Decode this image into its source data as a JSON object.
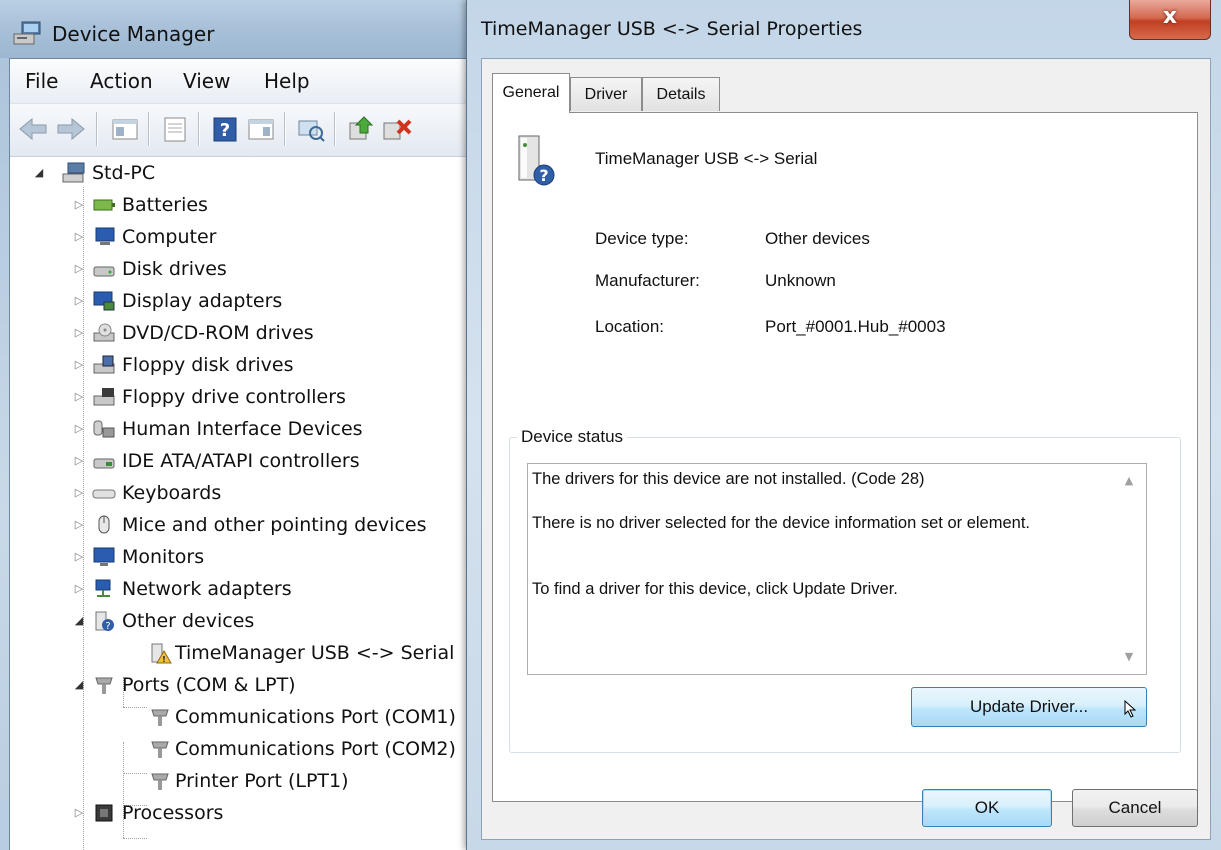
{
  "device_manager": {
    "title": "Device Manager",
    "menu": [
      "File",
      "Action",
      "View",
      "Help"
    ],
    "toolbar_icons": [
      "back-arrow-icon",
      "forward-arrow-icon",
      "show-hide-console-tree-icon",
      "properties-icon",
      "help-icon",
      "action-pane-icon",
      "scan-hardware-icon",
      "update-driver-icon",
      "uninstall-icon"
    ],
    "tree": {
      "root": "Std-PC",
      "categories": [
        {
          "label": "Batteries",
          "icon": "battery-icon",
          "expanded": false
        },
        {
          "label": "Computer",
          "icon": "computer-icon",
          "expanded": false
        },
        {
          "label": "Disk drives",
          "icon": "disk-drive-icon",
          "expanded": false
        },
        {
          "label": "Display adapters",
          "icon": "display-adapter-icon",
          "expanded": false
        },
        {
          "label": "DVD/CD-ROM drives",
          "icon": "dvd-drive-icon",
          "expanded": false
        },
        {
          "label": "Floppy disk drives",
          "icon": "floppy-drive-icon",
          "expanded": false
        },
        {
          "label": "Floppy drive controllers",
          "icon": "floppy-controller-icon",
          "expanded": false
        },
        {
          "label": "Human Interface Devices",
          "icon": "hid-icon",
          "expanded": false
        },
        {
          "label": "IDE ATA/ATAPI controllers",
          "icon": "ide-controller-icon",
          "expanded": false
        },
        {
          "label": "Keyboards",
          "icon": "keyboard-icon",
          "expanded": false
        },
        {
          "label": "Mice and other pointing devices",
          "icon": "mouse-icon",
          "expanded": false
        },
        {
          "label": "Monitors",
          "icon": "monitor-icon",
          "expanded": false
        },
        {
          "label": "Network adapters",
          "icon": "network-adapter-icon",
          "expanded": false
        },
        {
          "label": "Other devices",
          "icon": "unknown-device-icon",
          "expanded": true,
          "children": [
            {
              "label": "TimeManager USB <-> Serial",
              "icon": "warning-device-icon"
            }
          ]
        },
        {
          "label": "Ports (COM & LPT)",
          "icon": "port-icon",
          "expanded": true,
          "children": [
            {
              "label": "Communications Port (COM1)",
              "icon": "port-icon"
            },
            {
              "label": "Communications Port (COM2)",
              "icon": "port-icon"
            },
            {
              "label": "Printer Port (LPT1)",
              "icon": "port-icon"
            }
          ]
        },
        {
          "label": "Processors",
          "icon": "processor-icon",
          "expanded": false
        }
      ]
    }
  },
  "dialog": {
    "title": "TimeManager USB <-> Serial Properties",
    "close_glyph": "x",
    "tabs": [
      "General",
      "Driver",
      "Details"
    ],
    "active_tab": "General",
    "device_name": "TimeManager USB <-> Serial",
    "properties": [
      {
        "label": "Device type:",
        "value": "Other devices"
      },
      {
        "label": "Manufacturer:",
        "value": "Unknown"
      },
      {
        "label": "Location:",
        "value": "Port_#0001.Hub_#0003"
      }
    ],
    "status_group_label": "Device status",
    "status_text": "The drivers for this device are not installed. (Code 28)\n\nThere is no driver selected for the device information set or element.\n\n\nTo find a driver for this device, click Update Driver.",
    "update_driver_label": "Update Driver...",
    "ok_label": "OK",
    "cancel_label": "Cancel"
  }
}
